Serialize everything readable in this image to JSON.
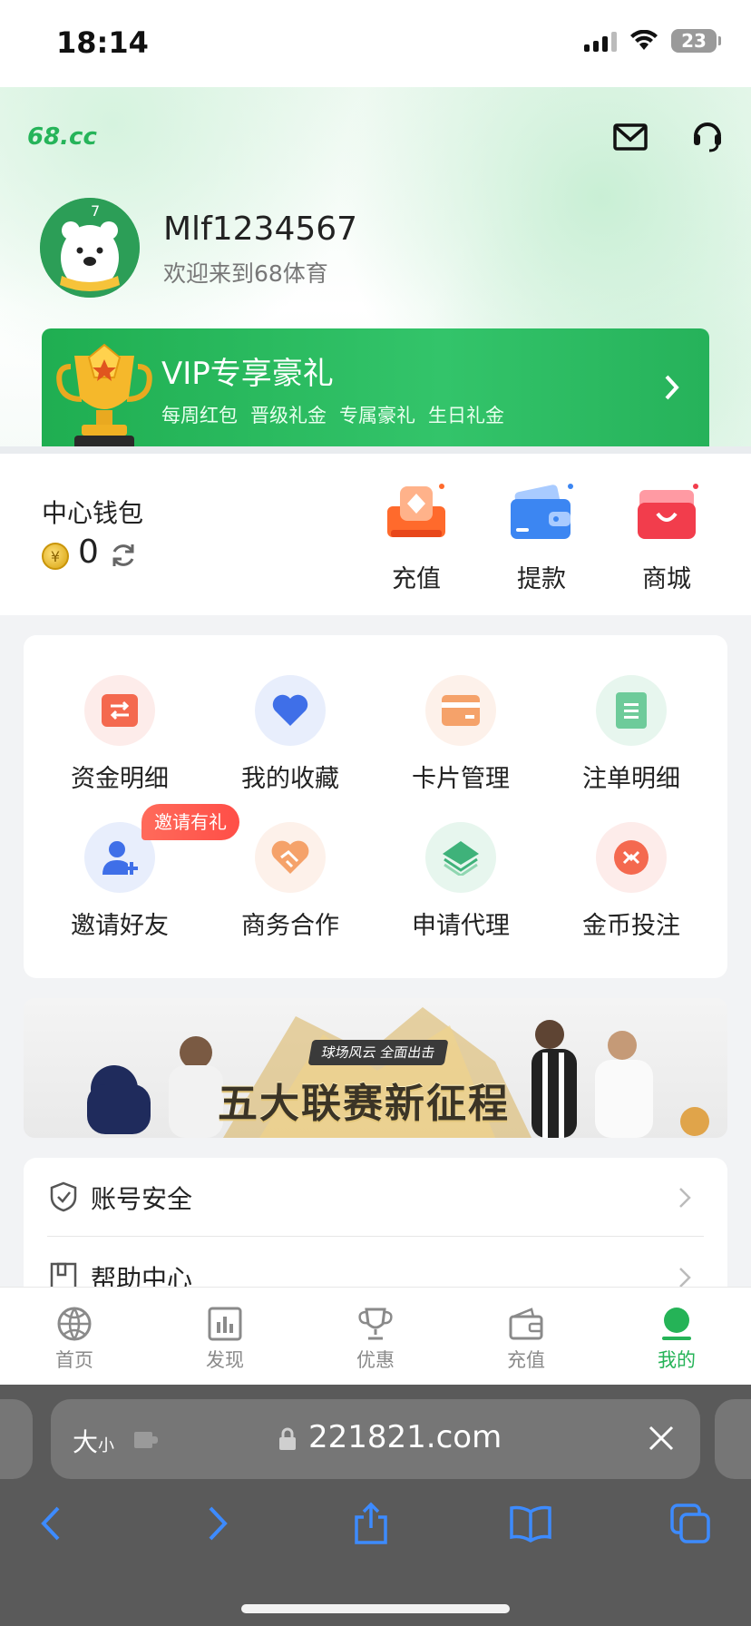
{
  "status_bar": {
    "time": "18:14",
    "battery": "23"
  },
  "header": {
    "logo": "68.cc",
    "username": "Mlf1234567",
    "welcome": "欢迎来到68体育"
  },
  "vip": {
    "title": "VIP专享豪礼",
    "perks": [
      "每周红包",
      "晋级礼金",
      "专属豪礼",
      "生日礼金"
    ]
  },
  "wallet": {
    "title": "中心钱包",
    "coin_symbol": "¥",
    "balance": "0",
    "actions": [
      {
        "label": "充值",
        "icon": "deposit-icon"
      },
      {
        "label": "提款",
        "icon": "withdraw-icon"
      },
      {
        "label": "商城",
        "icon": "shop-icon"
      }
    ]
  },
  "grid": {
    "items": [
      {
        "label": "资金明细",
        "icon": "transfer-icon"
      },
      {
        "label": "我的收藏",
        "icon": "heart-icon"
      },
      {
        "label": "卡片管理",
        "icon": "card-icon"
      },
      {
        "label": "注单明细",
        "icon": "document-icon"
      },
      {
        "label": "邀请好友",
        "icon": "add-user-icon"
      },
      {
        "label": "商务合作",
        "icon": "handshake-icon"
      },
      {
        "label": "申请代理",
        "icon": "layers-icon"
      },
      {
        "label": "金币投注",
        "icon": "coin-bet-icon"
      }
    ],
    "invite_badge": "邀请有礼"
  },
  "banner": {
    "subtitle": "球场风云 全面出击",
    "title": "五大联赛新征程"
  },
  "settings": [
    {
      "label": "账号安全",
      "icon": "shield-icon"
    },
    {
      "label": "帮助中心",
      "icon": "help-icon"
    }
  ],
  "bottom_nav": [
    {
      "label": "首页",
      "icon": "ball-icon"
    },
    {
      "label": "发现",
      "icon": "chart-icon"
    },
    {
      "label": "优惠",
      "icon": "trophy-icon"
    },
    {
      "label": "充值",
      "icon": "wallet-icon"
    },
    {
      "label": "我的",
      "icon": "profile-icon",
      "active": true
    }
  ],
  "browser": {
    "text_size": "大",
    "text_size_small": "小",
    "url": "221821.com"
  },
  "colors": {
    "brand_green": "#25b357",
    "vip_green": "#2bbd63",
    "deposit": "#ff6a2c",
    "withdraw": "#3c86f2",
    "shop": "#f23d4c",
    "badge_red": "#ff5a4c"
  }
}
